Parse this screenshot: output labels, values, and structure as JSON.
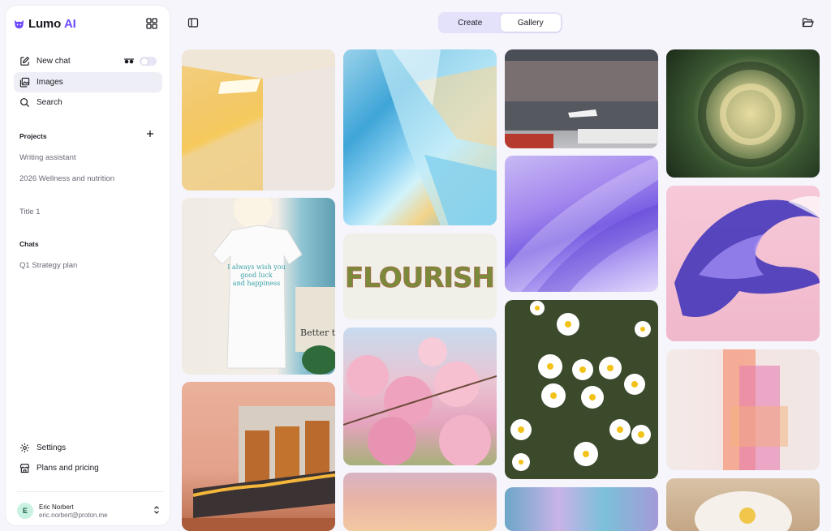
{
  "app": {
    "brand_name": "Lumo",
    "brand_suffix": "AI",
    "accent_color": "#6d4aff"
  },
  "sidebar": {
    "nav": [
      {
        "label": "New chat",
        "icon": "pencil-square-icon"
      },
      {
        "label": "Images",
        "icon": "images-icon",
        "active": true
      },
      {
        "label": "Search",
        "icon": "search-icon"
      }
    ],
    "ghost_mode_enabled": false,
    "projects_label": "Projects",
    "projects": [
      "Writing assistant",
      "2026 Wellness and nutrition",
      "Title 1"
    ],
    "chats_label": "Chats",
    "chats": [
      "Q1 Strategy plan"
    ],
    "settings_label": "Settings",
    "plans_label": "Plans and pricing",
    "user": {
      "initial": "E",
      "name": "Eric Norbert",
      "email": "eric.norbert@proton.me"
    }
  },
  "header": {
    "tabs": [
      {
        "label": "Create",
        "active": false
      },
      {
        "label": "Gallery",
        "active": true
      }
    ]
  },
  "gallery": {
    "tiles": [
      {
        "subject": "yellow-ceiling-light-photo"
      },
      {
        "subject": "t-shirt-on-hanger-photo",
        "shirt_text": [
          "I always wish you",
          "good luck",
          "and happiness"
        ],
        "sign_text": "Better th"
      },
      {
        "subject": "balcony-building-photo"
      },
      {
        "subject": "iridescent-glass-abstract"
      },
      {
        "subject": "flourish-moss-lettering",
        "text": "FLOURISH"
      },
      {
        "subject": "pink-cherry-blossom-photo"
      },
      {
        "subject": "pastel-sky-photo"
      },
      {
        "subject": "race-car-track-photo"
      },
      {
        "subject": "purple-liquid-abstract"
      },
      {
        "subject": "daisy-field-photo"
      },
      {
        "subject": "holographic-bubbles-abstract"
      },
      {
        "subject": "swirl-blur-foliage-photo"
      },
      {
        "subject": "chrome-purple-sculpture-render"
      },
      {
        "subject": "pink-glitch-figure-render"
      },
      {
        "subject": "white-peony-photo"
      }
    ]
  }
}
